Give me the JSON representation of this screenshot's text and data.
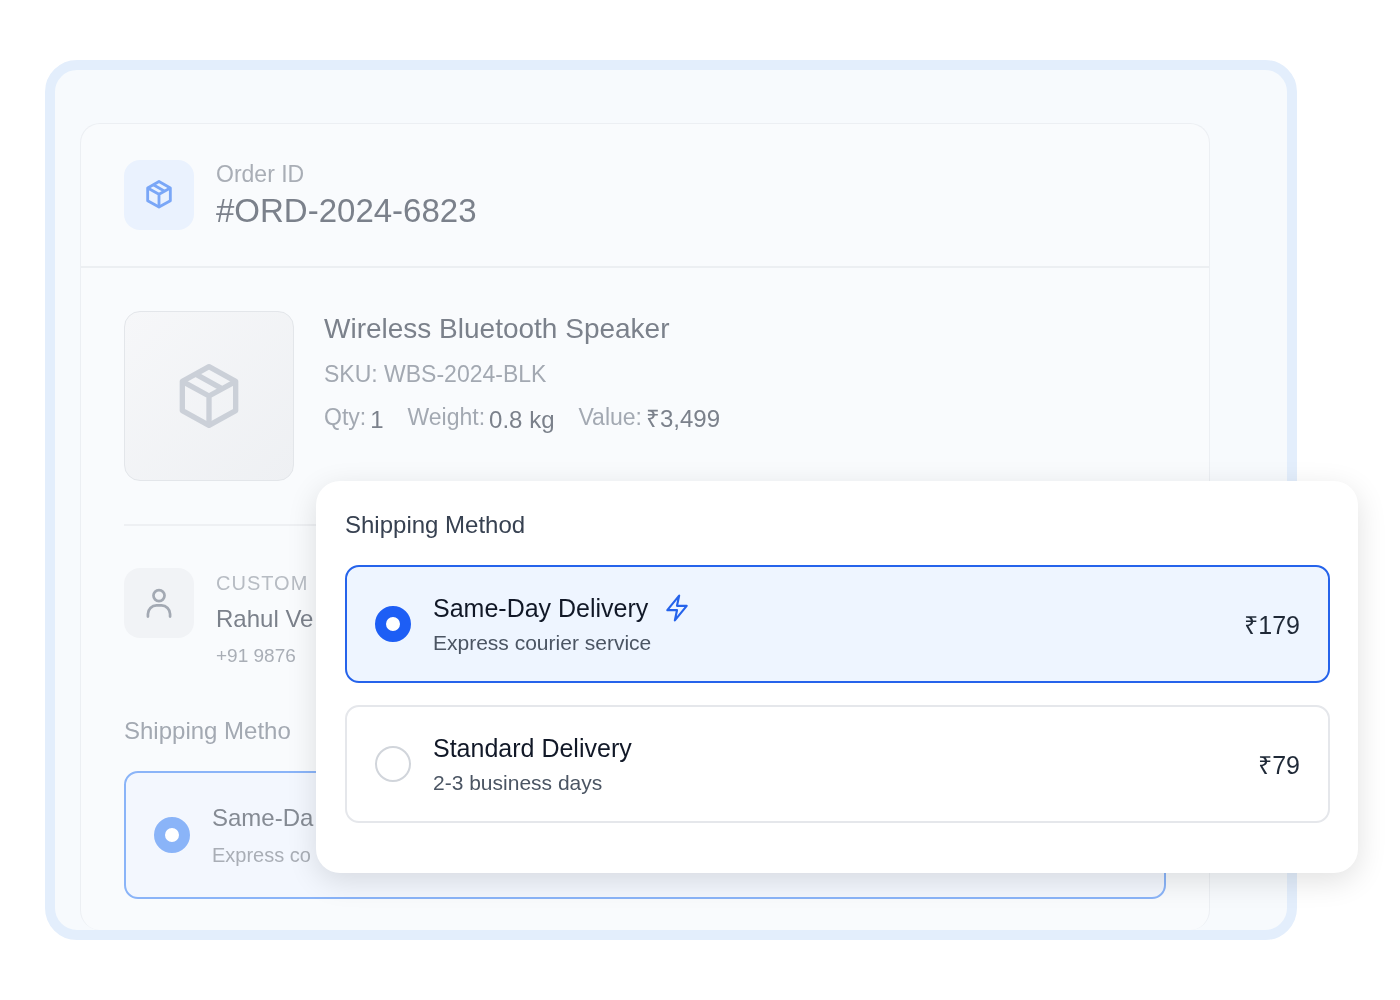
{
  "order": {
    "label": "Order ID",
    "id": "#ORD-2024-6823"
  },
  "product": {
    "name": "Wireless Bluetooth Speaker",
    "sku": "SKU: WBS-2024-BLK",
    "specs": [
      {
        "label": "Qty:",
        "value": "1"
      },
      {
        "label": "Weight:",
        "value": "0.8 kg"
      },
      {
        "label": "Value:",
        "value": "₹3,499"
      }
    ]
  },
  "customer": {
    "label": "CUSTOM",
    "name": "Rahul Ve",
    "phone": "+91 9876"
  },
  "shipping_behind": {
    "title": "Shipping Metho",
    "option": {
      "name": "Same-Da",
      "detail": "Express co",
      "selected": true
    }
  },
  "popup": {
    "title": "Shipping Method",
    "options": [
      {
        "name": "Same-Day Delivery",
        "detail": "Express courier service",
        "price": "₹179",
        "selected": true,
        "express": true
      },
      {
        "name": "Standard Delivery",
        "detail": "2-3 business days",
        "price": "₹79",
        "selected": false,
        "express": false
      }
    ]
  }
}
